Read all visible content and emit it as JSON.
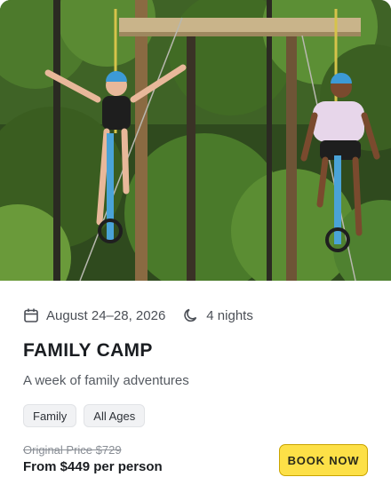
{
  "trip": {
    "dates": "August 24–28, 2026",
    "nights": "4 nights",
    "title": "FAMILY CAMP",
    "description": "A week of family adventures",
    "tags": [
      "Family",
      "All Ages"
    ],
    "original_price": "Original Price $729",
    "price": "From $449 per person",
    "book_label": "BOOK NOW"
  },
  "icons": {
    "dates": "calendar-icon",
    "nights": "moon-icon"
  },
  "colors": {
    "accent": "#fde047",
    "text": "#1a1d21",
    "muted": "#555a61"
  }
}
